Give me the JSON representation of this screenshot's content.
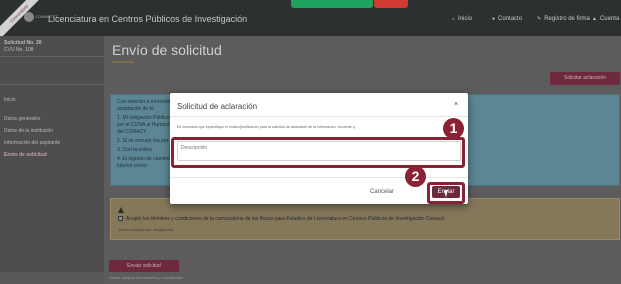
{
  "header": {
    "ribbon": "Convocatoria",
    "app_title": "Licenciatura en Centros Públicos de Investigación",
    "logo_text": "CONAHCYT",
    "nav": [
      {
        "label": "Inicio",
        "icon": "home-icon",
        "glyph": "⌂"
      },
      {
        "label": "Contacto",
        "icon": "chat-icon",
        "glyph": "●"
      },
      {
        "label": "Registro de firma",
        "icon": "pen-icon",
        "glyph": "✎"
      },
      {
        "label": "Cuenta",
        "icon": "user-icon",
        "glyph": "▲"
      }
    ]
  },
  "sidebar": {
    "solicitud_label": "Solicitud No. 20",
    "cvu_label": "CVU No. 108",
    "items": [
      {
        "label": "Inicio",
        "active": false
      },
      {
        "label": "Datos generales",
        "active": false
      },
      {
        "label": "Datos de la institución",
        "active": false
      },
      {
        "label": "Información del aspirante",
        "active": false
      },
      {
        "label": "Envío de solicitud",
        "active": true
      }
    ]
  },
  "main": {
    "page_title": "Envío de solicitud",
    "clarification_button": "Solicitar aclaración",
    "info_lines": [
      "Con relación a mi                                                                              investigación Conacyt), manifiesto expresamente la",
      "aceptación de lo:",
      "1. Mi obligación                                                                                 Públicos de Investigación Conacyt), emitida",
      "   por el CONA                                                                                   al Humano de Alto Nivel (Reglamento de Becas",
      "   del CONACY",
      "2. Si se encuen                                                                                  ma por el CONACYT.",
      "3. Con la entrec",
      "4. El ingreso de                                                                                 cuentre obligado a devolverlo o reintegrarlo",
      "   futuros convo"
    ],
    "terms_text": "Acepto los términos y condiciones de la convocatoria de las Becas para Estudios de Licenciatura en Centros Públicos de Investigación Conacyt",
    "required_note": "Estos campos son obligatorios",
    "send_button": "Enviar solicitud",
    "send_note": "Debes aceptar los términos y condiciones"
  },
  "modal": {
    "title": "Solicitud de aclaración",
    "close": "×",
    "help_text": "Es necesario que especifique el motivo/justificación para la solicitud de aclaración de la información, recuerde q",
    "textarea_placeholder": "Descripción",
    "cancel": "Cancelar",
    "send": "Enviar"
  },
  "annotations": {
    "step1": "1",
    "step2": "2"
  },
  "colors": {
    "brand": "#6e2a3c",
    "highlight": "#8b2233",
    "info_bg": "#5c8693",
    "warning_bg": "#84775a"
  }
}
